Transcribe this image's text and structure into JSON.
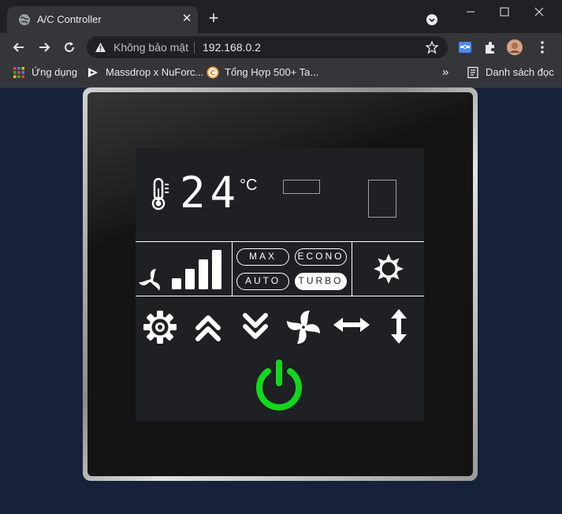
{
  "browser": {
    "tab": {
      "title": "A/C Controller",
      "close": "✕"
    },
    "new_tab": "+",
    "address_bar": {
      "security": "Không bảo mật",
      "url": "192.168.0.2"
    },
    "bookmarks": [
      {
        "label": "Ứng dụng"
      },
      {
        "label": "Massdrop x NuForc..."
      },
      {
        "label": "Tổng Hợp 500+ Ta..."
      },
      {
        "label": "Danh sách đọc"
      }
    ],
    "bookmarks_overflow": "»"
  },
  "controller": {
    "temperature": "24",
    "temperature_unit": "°C",
    "fan_level": 4,
    "modes": [
      {
        "label": "MAX",
        "active": false
      },
      {
        "label": "ECONO",
        "active": false
      },
      {
        "label": "AUTO",
        "active": false
      },
      {
        "label": "TURBO",
        "active": true
      }
    ],
    "controls": [
      "settings-icon",
      "temp-up-icon",
      "temp-down-icon",
      "fan-icon",
      "swing-horizontal-icon",
      "swing-vertical-icon"
    ],
    "power_color": "#12d81e",
    "accent": "#ffffff"
  }
}
